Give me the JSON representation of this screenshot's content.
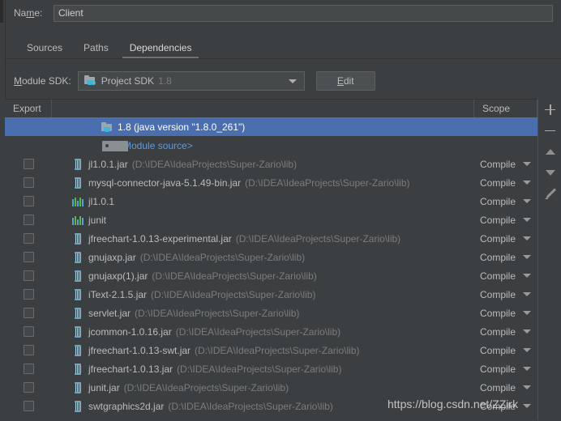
{
  "window": {
    "accent_selection": "#4b6eaf",
    "background": "#3c3f41"
  },
  "name_row": {
    "label_pre": "Na",
    "label_mnemonic": "m",
    "label_post": "e:",
    "value": "Client",
    "placeholder": ""
  },
  "tabs": [
    {
      "label": "Sources",
      "active": false
    },
    {
      "label": "Paths",
      "active": false
    },
    {
      "label": "Dependencies",
      "active": true
    }
  ],
  "sdk_row": {
    "label_mnemonic": "M",
    "label_rest": "odule SDK:",
    "combo_text": "Project SDK",
    "combo_version": "1.8",
    "edit_mnemonic": "E",
    "edit_rest": "dit"
  },
  "table": {
    "headers": {
      "export": "Export",
      "middle": "",
      "scope": "Scope"
    },
    "rows": [
      {
        "kind": "sdk",
        "icon": "sdk-folder-java-icon",
        "name": "1.8 (java version \"1.8.0_261\")",
        "path": "",
        "scope": "",
        "selected": true,
        "checkbox": false
      },
      {
        "kind": "module-source",
        "icon": "module-source-icon",
        "name": "<Module source>",
        "path": "",
        "scope": "",
        "selected": false,
        "checkbox": false
      },
      {
        "kind": "jar",
        "icon": "jar-icon",
        "name": "jl1.0.1.jar",
        "path": "(D:\\IDEA\\IdeaProjects\\Super-Zario\\lib)",
        "scope": "Compile",
        "selected": false,
        "checkbox": true
      },
      {
        "kind": "jar",
        "icon": "jar-icon",
        "name": "mysql-connector-java-5.1.49-bin.jar",
        "path": "(D:\\IDEA\\IdeaProjects\\Super-Zario\\lib)",
        "scope": "Compile",
        "selected": false,
        "checkbox": true
      },
      {
        "kind": "library",
        "icon": "library-icon",
        "name": "jl1.0.1",
        "path": "",
        "scope": "Compile",
        "selected": false,
        "checkbox": true
      },
      {
        "kind": "library",
        "icon": "library-icon",
        "name": "junit",
        "path": "",
        "scope": "Compile",
        "selected": false,
        "checkbox": true
      },
      {
        "kind": "jar",
        "icon": "jar-icon",
        "name": "jfreechart-1.0.13-experimental.jar",
        "path": "(D:\\IDEA\\IdeaProjects\\Super-Zario\\lib)",
        "scope": "Compile",
        "selected": false,
        "checkbox": true
      },
      {
        "kind": "jar",
        "icon": "jar-icon",
        "name": "gnujaxp.jar",
        "path": "(D:\\IDEA\\IdeaProjects\\Super-Zario\\lib)",
        "scope": "Compile",
        "selected": false,
        "checkbox": true
      },
      {
        "kind": "jar",
        "icon": "jar-icon",
        "name": "gnujaxp(1).jar",
        "path": "(D:\\IDEA\\IdeaProjects\\Super-Zario\\lib)",
        "scope": "Compile",
        "selected": false,
        "checkbox": true
      },
      {
        "kind": "jar",
        "icon": "jar-icon",
        "name": "iText-2.1.5.jar",
        "path": "(D:\\IDEA\\IdeaProjects\\Super-Zario\\lib)",
        "scope": "Compile",
        "selected": false,
        "checkbox": true
      },
      {
        "kind": "jar",
        "icon": "jar-icon",
        "name": "servlet.jar",
        "path": "(D:\\IDEA\\IdeaProjects\\Super-Zario\\lib)",
        "scope": "Compile",
        "selected": false,
        "checkbox": true
      },
      {
        "kind": "jar",
        "icon": "jar-icon",
        "name": "jcommon-1.0.16.jar",
        "path": "(D:\\IDEA\\IdeaProjects\\Super-Zario\\lib)",
        "scope": "Compile",
        "selected": false,
        "checkbox": true
      },
      {
        "kind": "jar",
        "icon": "jar-icon",
        "name": "jfreechart-1.0.13-swt.jar",
        "path": "(D:\\IDEA\\IdeaProjects\\Super-Zario\\lib)",
        "scope": "Compile",
        "selected": false,
        "checkbox": true
      },
      {
        "kind": "jar",
        "icon": "jar-icon",
        "name": "jfreechart-1.0.13.jar",
        "path": "(D:\\IDEA\\IdeaProjects\\Super-Zario\\lib)",
        "scope": "Compile",
        "selected": false,
        "checkbox": true
      },
      {
        "kind": "jar",
        "icon": "jar-icon",
        "name": "junit.jar",
        "path": "(D:\\IDEA\\IdeaProjects\\Super-Zario\\lib)",
        "scope": "Compile",
        "selected": false,
        "checkbox": true
      },
      {
        "kind": "jar",
        "icon": "jar-icon",
        "name": "swtgraphics2d.jar",
        "path": "(D:\\IDEA\\IdeaProjects\\Super-Zario\\lib)",
        "scope": "Compile",
        "selected": false,
        "checkbox": true
      }
    ]
  },
  "right_toolbar": [
    {
      "icon": "plus-icon",
      "name": "add-dependency-button"
    },
    {
      "icon": "minus-icon",
      "name": "remove-dependency-button"
    },
    {
      "icon": "arrow-up-icon",
      "name": "move-up-button"
    },
    {
      "icon": "arrow-down-icon",
      "name": "move-down-button"
    },
    {
      "icon": "pencil-icon",
      "name": "edit-dependency-button"
    }
  ],
  "watermark": {
    "text": "https://blog.csdn.net/ZZirk"
  }
}
